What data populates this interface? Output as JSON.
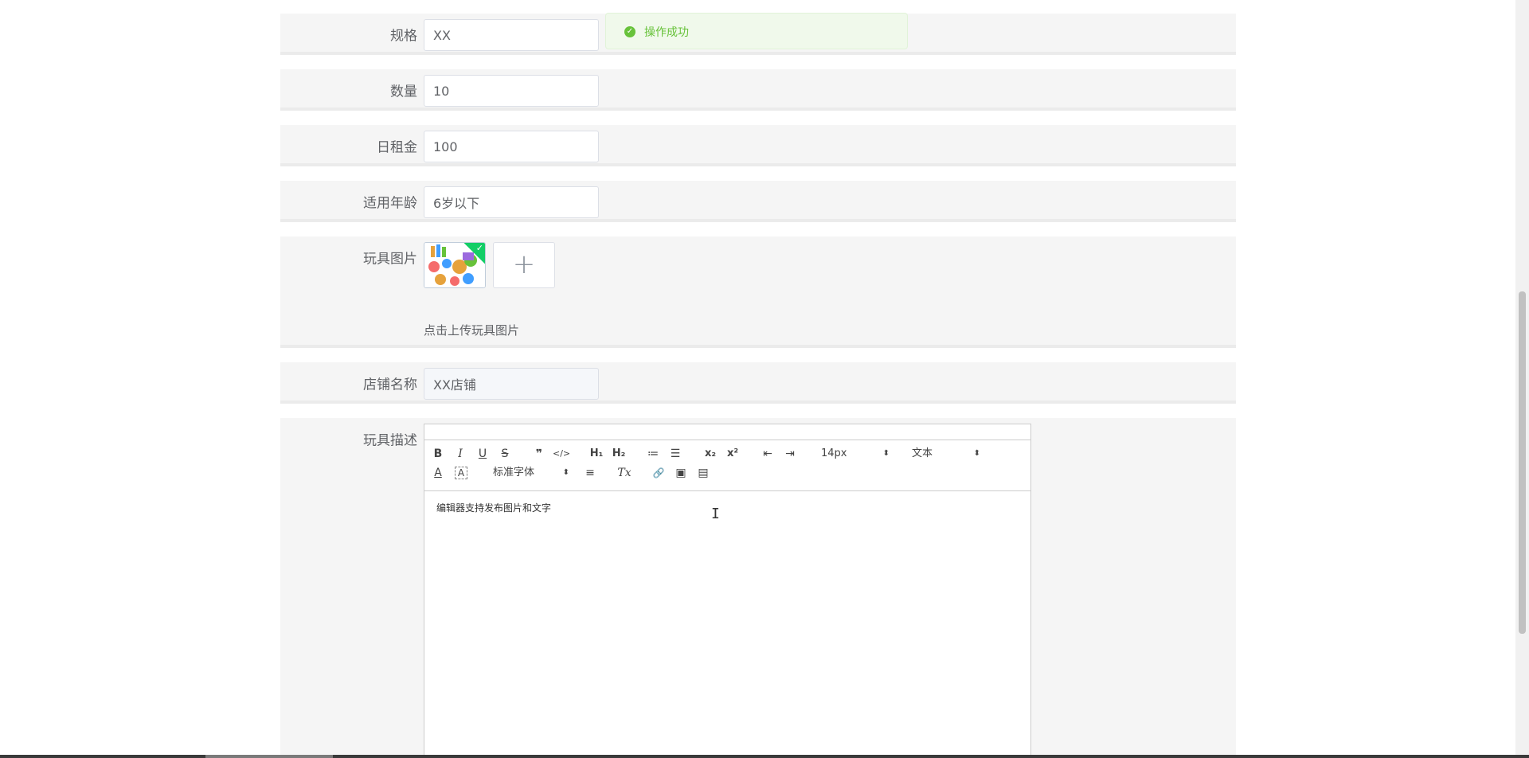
{
  "form": {
    "spec": {
      "label": "规格",
      "value": "XX"
    },
    "quantity": {
      "label": "数量",
      "value": "10"
    },
    "daily_rent": {
      "label": "日租金",
      "value": "100"
    },
    "age": {
      "label": "适用年龄",
      "value": "6岁以下"
    },
    "toy_image": {
      "label": "玩具图片",
      "tip": "点击上传玩具图片",
      "add_symbol": "+"
    },
    "shop_name": {
      "label": "店铺名称",
      "value": "XX店铺"
    },
    "toy_desc": {
      "label": "玩具描述"
    }
  },
  "editor": {
    "toolbar": {
      "bold": "B",
      "italic": "I",
      "underline": "U",
      "strike": "S",
      "blockquote": "❞",
      "code": "</>",
      "h1": "H₁",
      "h2": "H₂",
      "ordered_list": "≔",
      "bullet_list": "☰",
      "subscript": "x₂",
      "superscript": "x²",
      "outdent": "⇤",
      "indent": "⇥",
      "size": "14px",
      "header": "文本",
      "font_color": "A",
      "background": "A",
      "font_family": "标准字体",
      "align": "≡",
      "clean": "Tx",
      "link": "🔗",
      "image": "▣",
      "video": "▤",
      "caret": "⬍"
    },
    "placeholder": "编辑器支持发布图片和文字",
    "cursor": "I"
  },
  "toast": {
    "message": "操作成功",
    "icon": "✓"
  },
  "colors": {
    "success": "#67c23a",
    "row_bg": "#f5f5f5",
    "badge": "#13ce66"
  }
}
